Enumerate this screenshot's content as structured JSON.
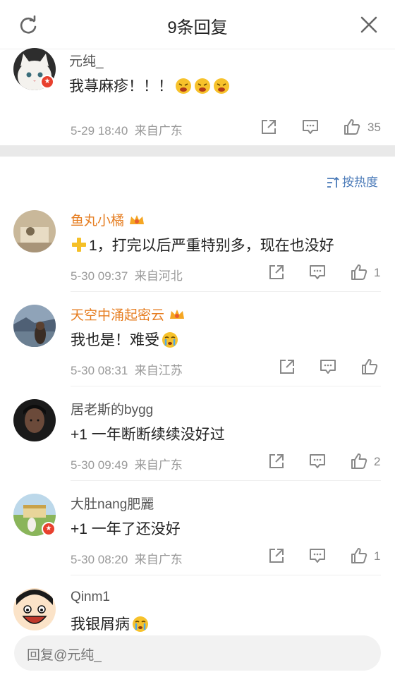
{
  "header": {
    "title": "9条回复"
  },
  "root_comment": {
    "username": "元纯_",
    "content": "我荨麻疹！！！",
    "emoji_count": 3,
    "time": "5-29 18:40",
    "source": "来自广东",
    "likes": "35"
  },
  "sort": {
    "label": "按热度"
  },
  "replies": [
    {
      "username": "鱼丸小橘",
      "content": "1，打完以后严重特别多，现在也没好",
      "time": "5-30 09:37",
      "source": "来自河北",
      "likes": "1"
    },
    {
      "username": "天空中涌起密云",
      "content": "我也是！难受",
      "time": "5-30 08:31",
      "source": "来自江苏",
      "likes": ""
    },
    {
      "username": "居老斯的bygg",
      "content": "+1 一年断断续续没好过",
      "time": "5-30 09:49",
      "source": "来自广东",
      "likes": "2"
    },
    {
      "username": "大肚nang肥麗",
      "content": "+1 一年了还没好",
      "time": "5-30 08:20",
      "source": "来自广东",
      "likes": "1"
    },
    {
      "username": "Qinm1",
      "content": "我银屑病",
      "time": "",
      "source": "",
      "likes": ""
    }
  ],
  "reply_input": {
    "placeholder": "回复@元纯_"
  },
  "colors": {
    "accent": "#4a7ab8",
    "vip_name": "#e67e22",
    "badge": "#e8402e"
  }
}
